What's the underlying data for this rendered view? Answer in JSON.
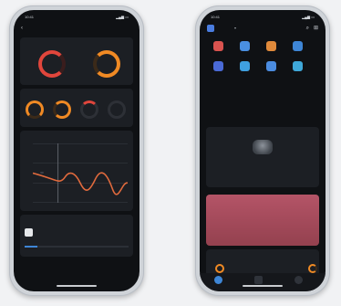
{
  "left_phone": {
    "status": {
      "time": "10:41",
      "center_time": "",
      "right": "",
      "right_glyph": "▂▄▆ ▭"
    },
    "header": {
      "title": ""
    },
    "card1": {
      "title": "",
      "rings": [
        {
          "value": "",
          "label": ""
        },
        {
          "value": "",
          "label": ""
        }
      ]
    },
    "card2": {
      "title": "",
      "pill": "",
      "rings": [
        {
          "label": ""
        },
        {
          "label": ""
        },
        {
          "label": ""
        },
        {
          "label": ""
        }
      ]
    },
    "card3": {
      "title": "",
      "y_labels": [
        "",
        "",
        "",
        ""
      ],
      "tooltip": "",
      "x_labels": [
        "",
        "",
        "",
        "",
        "",
        ""
      ]
    },
    "card4": {
      "title": "",
      "item": "",
      "item_sub": ""
    }
  },
  "right_phone": {
    "status": {
      "time": "10:41",
      "right": "",
      "right_glyph": "▂▄▆ ▭"
    },
    "header": {
      "app_label": "",
      "dropdown_glyph": "▾"
    },
    "apps_row1": [
      {
        "color": "#d9534f",
        "label": ""
      },
      {
        "color": "#4a8fe0",
        "label": ""
      },
      {
        "color": "#e08a3b",
        "label": ""
      },
      {
        "color": "#3e86d6",
        "label": ""
      }
    ],
    "apps_row2": [
      {
        "color": "#4a6ad6",
        "label": ""
      },
      {
        "color": "#3fa0e0",
        "label": ""
      },
      {
        "color": "#4b8ce0",
        "label": ""
      },
      {
        "color": "#3fa8d9",
        "label": ""
      }
    ],
    "card_security": {
      "title": "",
      "pill": "",
      "caption": ""
    },
    "card_pink": {
      "title": "",
      "subtitle": ""
    },
    "card_stats": {
      "title": "",
      "tabs": [
        "",
        "",
        ""
      ]
    }
  },
  "colors": {
    "ring_orange": "#f08a24",
    "ring_red": "#e0463c",
    "pink_banner": "#a84a5d",
    "chart_line": "#e06a3d"
  }
}
